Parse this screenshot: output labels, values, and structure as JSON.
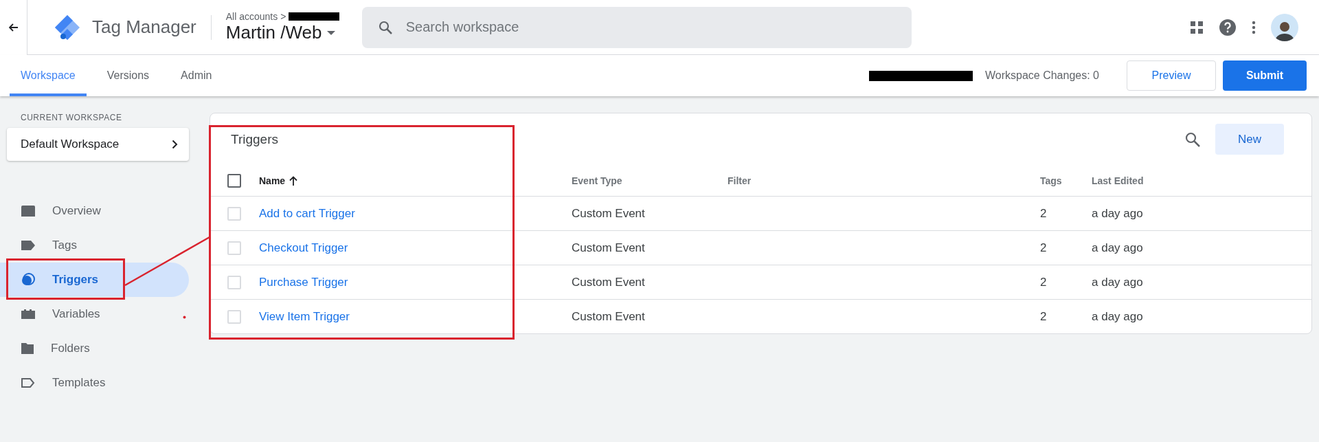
{
  "header": {
    "product": "Tag Manager",
    "breadcrumb": "All accounts >",
    "container": "Martin /Web",
    "search": {
      "placeholder": "Search workspace"
    }
  },
  "tabs": [
    {
      "label": "Workspace",
      "selected": true
    },
    {
      "label": "Versions",
      "selected": false
    },
    {
      "label": "Admin",
      "selected": false
    }
  ],
  "workspace_bar": {
    "changes": "Workspace Changes: 0",
    "buttons": [
      {
        "label": "Preview",
        "kind": "outlined"
      },
      {
        "label": "Submit",
        "kind": "filled"
      }
    ]
  },
  "sidebar": {
    "section_label": "CURRENT WORKSPACE",
    "workspace": "Default Workspace",
    "items": [
      {
        "label": "Overview",
        "kind": "overview",
        "selected": false
      },
      {
        "label": "Tags",
        "kind": "tag",
        "selected": false
      },
      {
        "label": "Triggers",
        "kind": "trigger",
        "selected": true
      },
      {
        "label": "Variables",
        "kind": "variable",
        "selected": false
      },
      {
        "label": "Folders",
        "kind": "folder",
        "selected": false
      },
      {
        "label": "Templates",
        "kind": "template",
        "selected": false
      }
    ]
  },
  "triggers": {
    "title": "Triggers",
    "new_button": "New",
    "select_all": {
      "checked": false
    },
    "columns": [
      "Name",
      "Event Type",
      "Filter",
      "Tags",
      "Last Edited"
    ],
    "rows": [
      {
        "name": "Add to cart Trigger",
        "event_type": "Custom Event",
        "tags": "2",
        "last_edited": "a day ago",
        "checked": false
      },
      {
        "name": "Checkout Trigger",
        "event_type": "Custom Event",
        "tags": "2",
        "last_edited": "a day ago",
        "checked": false
      },
      {
        "name": "Purchase Trigger",
        "event_type": "Custom Event",
        "tags": "2",
        "last_edited": "a day ago",
        "checked": false
      },
      {
        "name": "View Item Trigger",
        "event_type": "Custom Event",
        "tags": "2",
        "last_edited": "a day ago",
        "checked": false
      }
    ]
  }
}
